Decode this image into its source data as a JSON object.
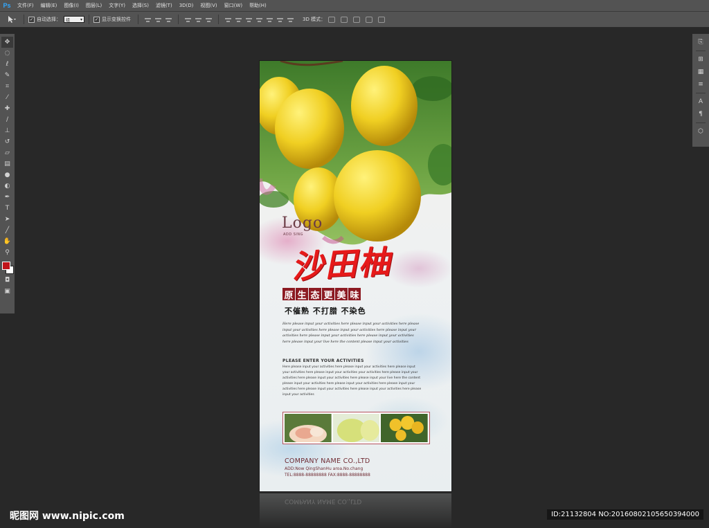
{
  "app": {
    "logo": "Ps",
    "menu": [
      "文件(F)",
      "编辑(E)",
      "图像(I)",
      "图层(L)",
      "文字(Y)",
      "选择(S)",
      "滤镜(T)",
      "3D(D)",
      "视图(V)",
      "窗口(W)",
      "帮助(H)"
    ]
  },
  "options": {
    "auto_select_label": "自动选择：",
    "auto_select_value": "组",
    "show_transform_label": "显示变换控件",
    "mode_3d_label": "3D 模式："
  },
  "toolbar": {
    "tools": [
      "move-tool",
      "marquee-tool",
      "lasso-tool",
      "quick-select-tool",
      "crop-tool",
      "eyedropper-tool",
      "healing-tool",
      "brush-tool",
      "stamp-tool",
      "history-brush-tool",
      "eraser-tool",
      "gradient-tool",
      "blur-tool",
      "dodge-tool",
      "pen-tool",
      "type-tool",
      "path-select-tool",
      "shape-tool",
      "hand-tool",
      "zoom-tool"
    ],
    "foreground_color": "#c1141a",
    "background_color": "#ffffff"
  },
  "poster": {
    "logo": "Logo",
    "logo_sub": "ADD SING",
    "title": "沙田柚",
    "slogan_chars": [
      "原",
      "生",
      "态",
      "更",
      "美",
      "味"
    ],
    "slogan2": "不催熟 不打腊 不染色",
    "script_paragraph": "Here please input your activities here please input your activities here please input your activities here please input your activities here please input your activities here please input your activities here please input your activities here please input your live here the content please input your activities",
    "activities_title": "PLEASE ENTER YOUR ACTIVITIES",
    "activities_body": "Here please input your activities here please input your activities here please input your activities here please input your activities your activities here please input your activities here please input your activities here please input your live here the content please input your activities here please input your activities here please input your activities here please input your activities here please input your activities here please input your activities",
    "company": "COMPANY NAME CO.,LTD",
    "address": "ADD:Now QingShanHu aroa.No.chang",
    "tel_fax": "TEL:8888-88888888   FAX:8888-88888888",
    "accent_color": "#e61a1a",
    "brand_color": "#8c1a22"
  },
  "watermark": {
    "left": "昵图网 www.nipic.com",
    "right": "ID:21132804 NO:20160802105650394000"
  }
}
